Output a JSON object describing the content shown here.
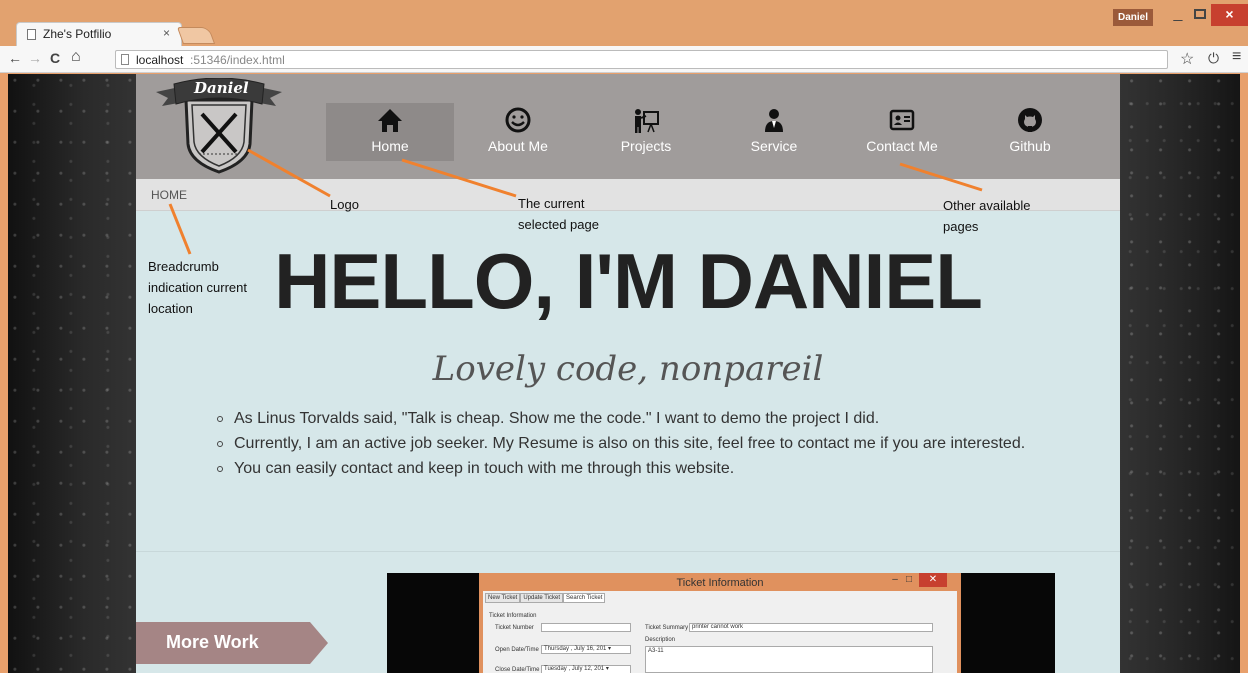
{
  "browser": {
    "tab_title": "Zhe's Potfilio",
    "tab_close": "×",
    "user_name": "Daniel",
    "url_host": "localhost",
    "url_path": ":51346/index.html",
    "back": "←",
    "forward": "→",
    "reload": "C",
    "home": "⌂",
    "bookmark": "☆",
    "power": "⏻",
    "menu": "≡",
    "minimize": "_",
    "close": "×"
  },
  "site": {
    "logo_text": "Daniel",
    "nav": [
      {
        "label": "Home",
        "icon": "home-icon",
        "active": true
      },
      {
        "label": "About Me",
        "icon": "smiley-icon"
      },
      {
        "label": "Projects",
        "icon": "presentation-icon"
      },
      {
        "label": "Service",
        "icon": "person-icon"
      },
      {
        "label": "Contact Me",
        "icon": "contact-card-icon"
      },
      {
        "label": "Github",
        "icon": "github-icon"
      }
    ],
    "breadcrumb": "HOME",
    "hero_title": "HELLO, I'M DANIEL",
    "hero_subtitle": "Lovely code, nonpareil",
    "bullets": [
      "As Linus Torvalds said, \"Talk is cheap. Show me the code.\" I want to demo the project I did.",
      "Currently, I am an active job seeker. My Resume is also on this site, feel free to contact me if you are interested.",
      "You can easily contact and keep in touch with me through this website."
    ],
    "more_work": "More Work",
    "project_shot": {
      "window_title": "Ticket Information",
      "tabs": [
        "New Ticket",
        "Update Ticket",
        "Search Ticket"
      ],
      "group_label": "Ticket Information",
      "ticket_number_label": "Ticket Number",
      "ticket_summary_label": "Ticket Summary",
      "ticket_summary_value": "printer cannot work",
      "description_label": "Description",
      "description_value": "A3-11",
      "open_date_label": "Open Date/Time",
      "open_date_value": "Thursday ,   July   16, 201 ▾",
      "close_date_label": "Close Date/Time",
      "close_date_value": "Tuesday ,   July   12, 201 ▾"
    }
  },
  "annotations": {
    "logo": "Logo",
    "current_page": "The current selected page",
    "other_pages": "Other available pages",
    "breadcrumb": "Breadcrumb indication current location"
  },
  "colors": {
    "chrome": "#e2a26f",
    "header": "#a09c9b",
    "nav_active": "#8e8a89",
    "content_bg": "#d6e7e9",
    "more_work": "#a58585",
    "annotation_line": "#f0812e"
  }
}
